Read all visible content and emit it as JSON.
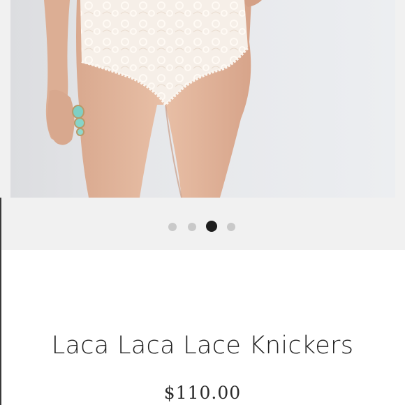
{
  "product": {
    "title": "Laca Laca Lace Knickers",
    "price": "$110.00"
  },
  "carousel": {
    "image_subject": "lace-knickers-photo",
    "slide_count": 4,
    "active_index": 2
  },
  "colors": {
    "carousel_background": "#f1f1f1",
    "dot_inactive": "#c9c9c9",
    "dot_active": "#1e1e1e",
    "text": "#222222"
  }
}
